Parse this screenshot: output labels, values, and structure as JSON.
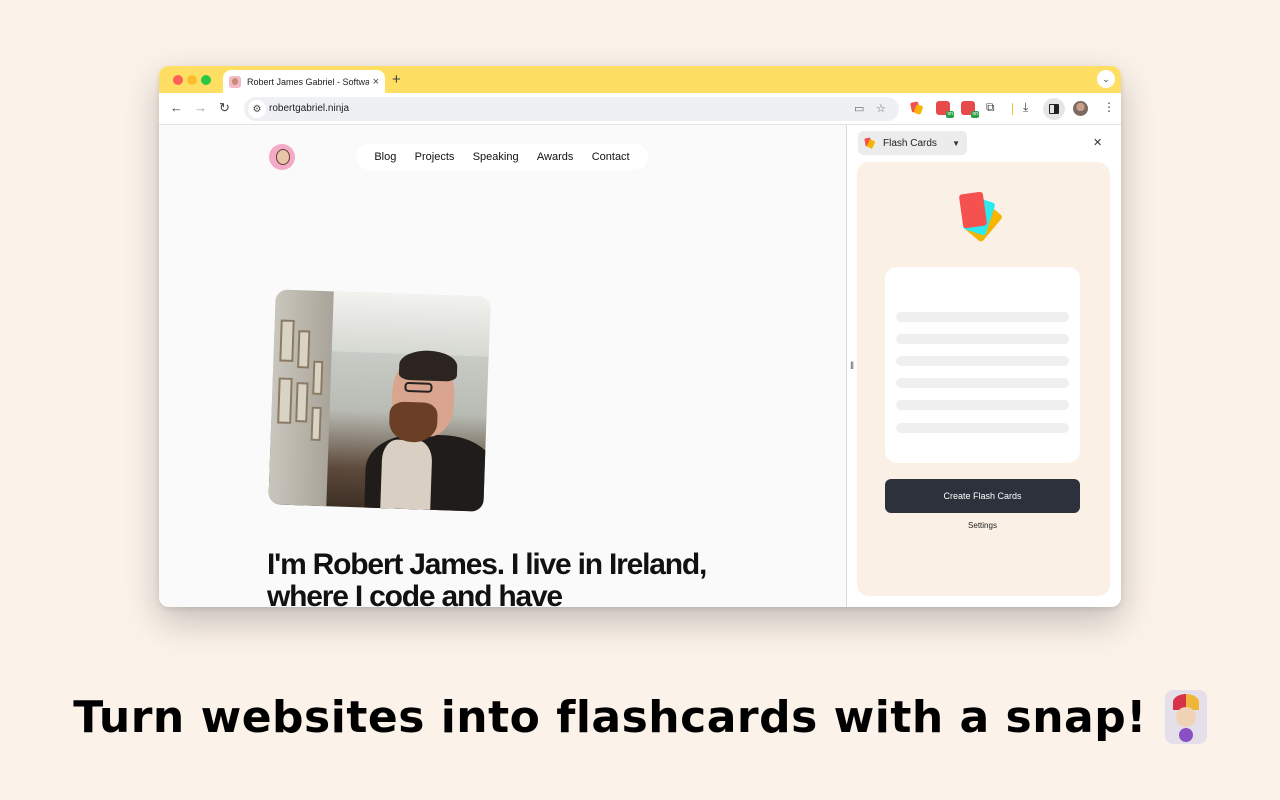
{
  "browser": {
    "tab_title": "Robert James Gabriel - Software Engineer",
    "tab_close_glyph": "×",
    "new_tab_glyph": "+",
    "url": "robertgabriel.ninja",
    "extension_badge": "on"
  },
  "site": {
    "nav": [
      "Blog",
      "Projects",
      "Speaking",
      "Awards",
      "Contact"
    ],
    "heading": "I'm Robert James. I live in Ireland, where I code and have"
  },
  "side_panel": {
    "select_label": "Flash Cards",
    "create_button": "Create Flash Cards",
    "settings_link": "Settings"
  },
  "tagline": "Turn websites into flashcards with a snap!",
  "colors": {
    "tab_bar": "#fedf63",
    "page_background": "#fbf2e9",
    "card_background": "#fbf0e6",
    "button": "#2c313c"
  }
}
